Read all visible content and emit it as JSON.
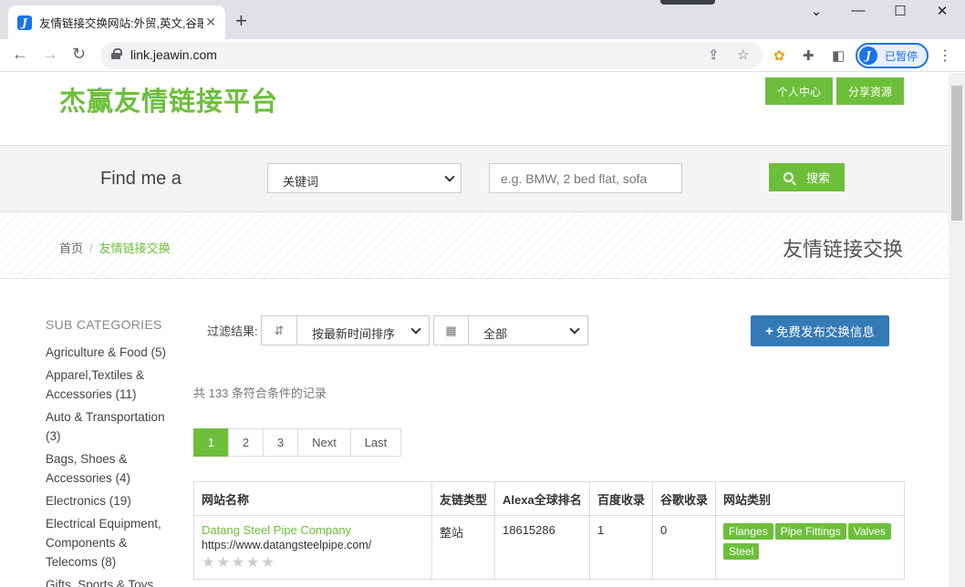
{
  "browser": {
    "tab_title": "友情链接交换网站:外贸,英文,谷歌",
    "url": "link.jeawin.com",
    "profile_label": "已暂停",
    "favicon_letter": "J",
    "icons": [
      "back-icon",
      "forward-icon",
      "reload-icon",
      "lock-icon",
      "share-icon",
      "bookmark-star-icon",
      "extension-icon",
      "puzzle-icon",
      "sidebar-icon",
      "menu-icon"
    ]
  },
  "header": {
    "logo": "杰赢友情链接平台",
    "user_center": "个人中心",
    "share_resources": "分享资源"
  },
  "search": {
    "find_me": "Find me a",
    "keyword_selected": "关键词",
    "input_placeholder": "e.g. BMW, 2 bed flat, sofa",
    "button": "搜索"
  },
  "breadcrumb": {
    "home": "首页",
    "separator": "/",
    "current": "友情链接交换"
  },
  "page_heading": "友情链接交换",
  "sidebar": {
    "title": "SUB CATEGORIES",
    "items": [
      "Agriculture & Food (5)",
      "Apparel,Textiles & Accessories (11)",
      "Auto & Transportation (3)",
      "Bags, Shoes & Accessories (4)",
      "Electronics (19)",
      "Electrical Equipment, Components & Telecoms (8)",
      "Gifts, Sports & Toys"
    ]
  },
  "filter": {
    "label": "过滤结果:",
    "sort_selected": "按最新时间排序",
    "scope_selected": "全部",
    "publish_button": "免费发布交换信息"
  },
  "result_count": "共 133 条符合条件的记录",
  "pagination": {
    "pages": [
      "1",
      "2",
      "3",
      "Next",
      "Last"
    ],
    "current": "1"
  },
  "table": {
    "headers": [
      "网站名称",
      "友链类型",
      "Alexa全球排名",
      "百度收录",
      "谷歌收录",
      "网站类别"
    ],
    "rows": [
      {
        "name": "Datang Steel Pipe Company",
        "url": "https://www.datangsteelpipe.com/",
        "stars": "★★★★★",
        "type": "整站",
        "alexa": "18615286",
        "baidu": "1",
        "google": "0",
        "tags": [
          "Flanges",
          "Pipe Fittings",
          "Valves",
          "Steel"
        ]
      }
    ]
  },
  "colors": {
    "brand_green": "#6dbf3b",
    "publish_blue": "#337ab7"
  }
}
